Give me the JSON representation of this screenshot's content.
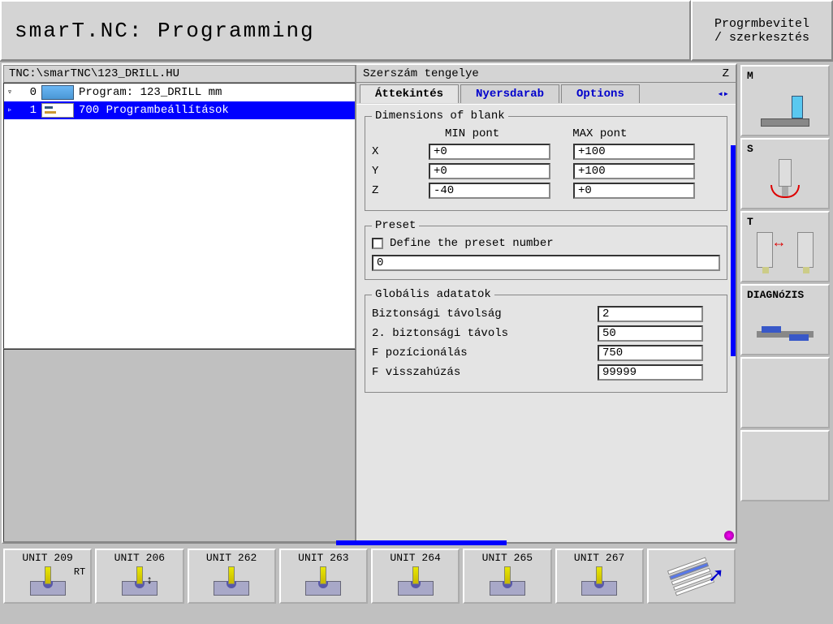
{
  "header": {
    "title": "smarT.NC: Programming",
    "mode_line1": "Progrmbevitel",
    "mode_line2": "/ szerkesztés"
  },
  "path": "TNC:\\smarTNC\\123_DRILL.HU",
  "tree": [
    {
      "glyph": "▿",
      "num": "0",
      "label": "Program: 123_DRILL mm",
      "selected": false,
      "icon": "prog"
    },
    {
      "glyph": "▹",
      "num": "1",
      "label": "700 Programbeállítások",
      "selected": true,
      "icon": "set"
    }
  ],
  "form": {
    "header_label": "Szerszám tengelye",
    "header_value": "Z",
    "tabs": [
      {
        "label": "Áttekintés",
        "active": true,
        "blue": false
      },
      {
        "label": "Nyersdarab",
        "active": false,
        "blue": true
      },
      {
        "label": "Options",
        "active": false,
        "blue": true
      }
    ],
    "dimensions": {
      "legend": "Dimensions of blank",
      "min_label": "MIN pont",
      "max_label": "MAX pont",
      "rows": [
        {
          "axis": "X",
          "min": "+0",
          "max": "+100"
        },
        {
          "axis": "Y",
          "min": "+0",
          "max": "+100"
        },
        {
          "axis": "Z",
          "min": "-40",
          "max": "+0"
        }
      ]
    },
    "preset": {
      "legend": "Preset",
      "check_label": "Define the preset number",
      "value": "0"
    },
    "global": {
      "legend": "Globális adatatok",
      "rows": [
        {
          "label": "Biztonsági távolság",
          "value": "2"
        },
        {
          "label": "2. biztonsági távols",
          "value": "50"
        },
        {
          "label": "F pozícionálás",
          "value": "750"
        },
        {
          "label": "F visszahúzás",
          "value": "99999"
        }
      ]
    }
  },
  "softkeys": [
    {
      "label": "UNIT 209",
      "rt": "RT"
    },
    {
      "label": "UNIT 206",
      "rt": ""
    },
    {
      "label": "UNIT 262",
      "rt": ""
    },
    {
      "label": "UNIT 263",
      "rt": ""
    },
    {
      "label": "UNIT 264",
      "rt": ""
    },
    {
      "label": "UNIT 265",
      "rt": ""
    },
    {
      "label": "UNIT 267",
      "rt": ""
    }
  ],
  "side": [
    {
      "letter": "M",
      "type": "machine"
    },
    {
      "letter": "S",
      "type": "spindle"
    },
    {
      "letter": "T",
      "type": "tool"
    },
    {
      "letter": "DIAGNóZIS",
      "type": "diag"
    },
    {
      "letter": "",
      "type": "empty"
    },
    {
      "letter": "",
      "type": "empty"
    }
  ]
}
